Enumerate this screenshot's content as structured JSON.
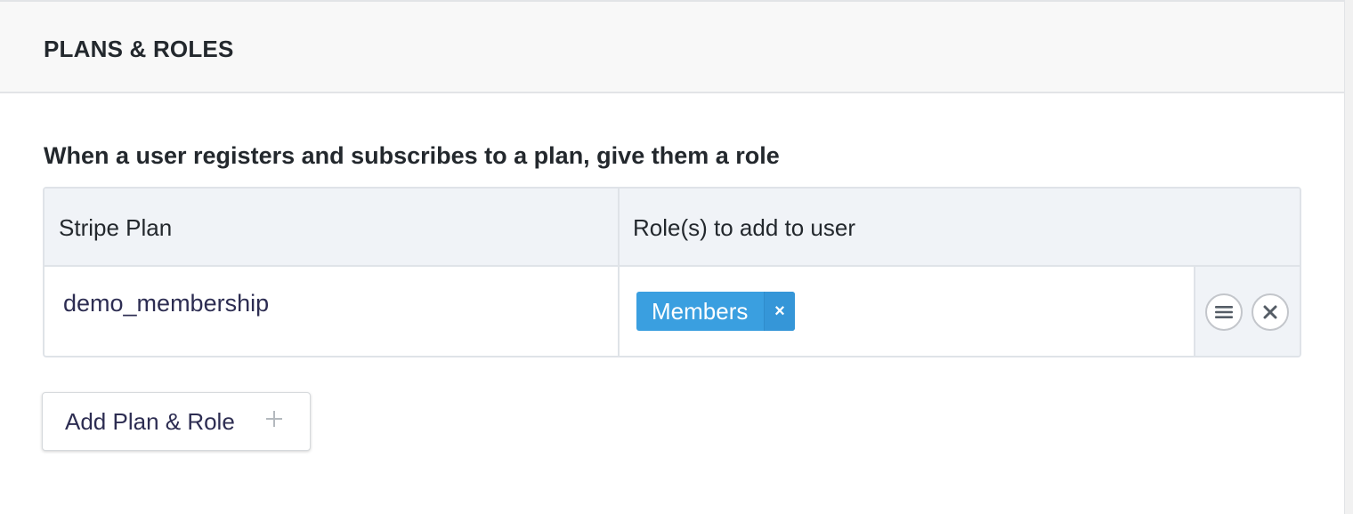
{
  "panel": {
    "title": "PLANS & ROLES",
    "description": "When a user registers and subscribes to a plan, give them a role"
  },
  "table": {
    "headers": [
      "Stripe Plan",
      "Role(s) to add to user"
    ],
    "rows": [
      {
        "plan": "demo_membership",
        "roles": [
          "Members"
        ]
      }
    ],
    "row_actions": {
      "reorder_icon": "menu-lines-icon",
      "remove_icon": "close-icon"
    }
  },
  "add_button": {
    "label": "Add Plan & Role",
    "icon": "plus-icon"
  },
  "tag_remove_glyph": "×",
  "colors": {
    "tag": "#3a9fe0",
    "header_bg": "#f0f3f7",
    "border": "#dfe3e8"
  }
}
